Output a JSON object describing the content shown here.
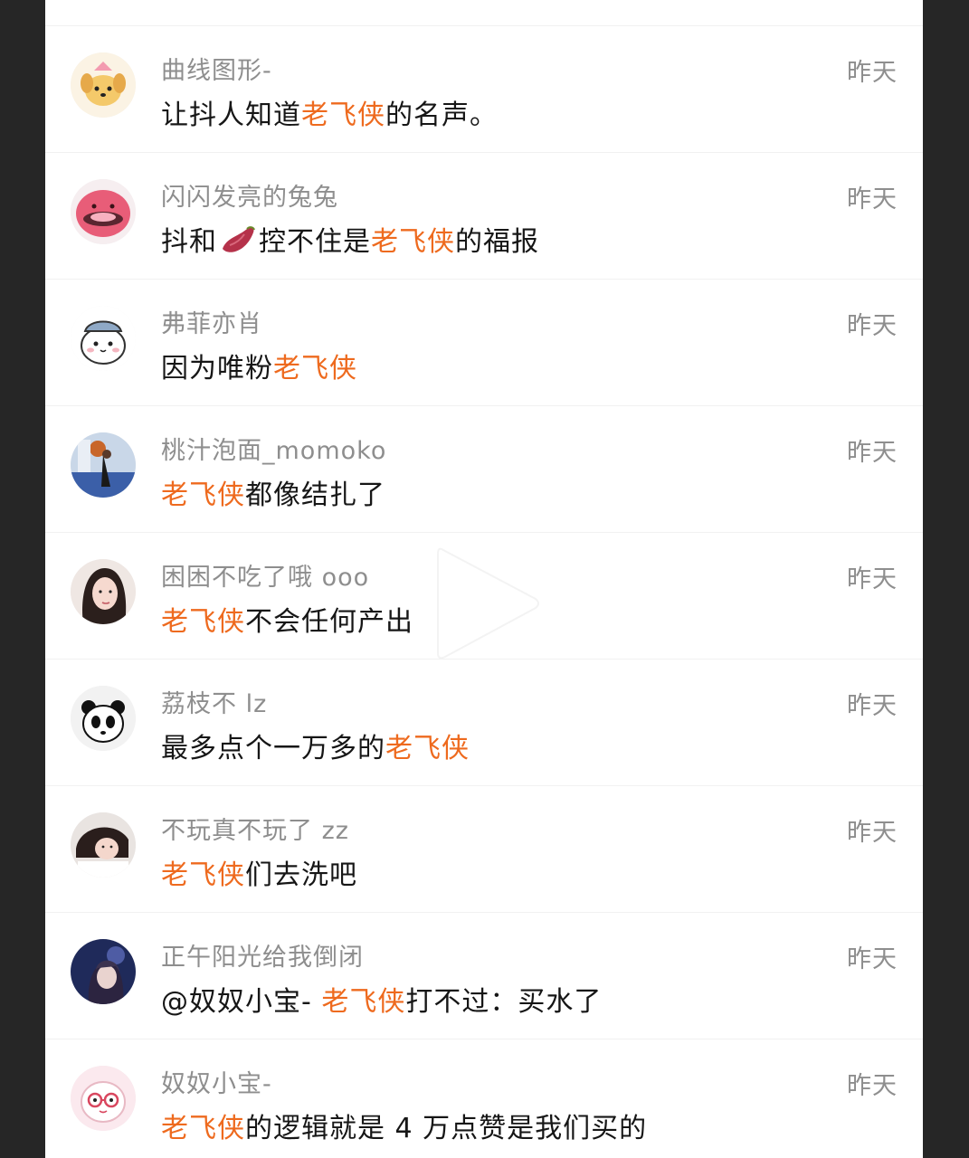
{
  "colors": {
    "highlight": "#ee6a1e",
    "username": "#8e8e8e",
    "text": "#161616",
    "frame": "#262626"
  },
  "comments": [
    {
      "username": "曲线图形-",
      "time": "昨天",
      "parts": [
        {
          "t": "让抖人知道",
          "hl": false
        },
        {
          "t": "老飞侠",
          "hl": true
        },
        {
          "t": "的名声。",
          "hl": false
        }
      ]
    },
    {
      "username": "闪闪发亮的兔兔",
      "time": "昨天",
      "parts": [
        {
          "t": "抖和",
          "hl": false
        },
        {
          "emoji": "sweet-potato-icon"
        },
        {
          "t": "控不住是",
          "hl": false
        },
        {
          "t": "老飞侠",
          "hl": true
        },
        {
          "t": "的福报",
          "hl": false
        }
      ]
    },
    {
      "username": "弗菲亦肖",
      "time": "昨天",
      "parts": [
        {
          "t": "因为唯粉",
          "hl": false
        },
        {
          "t": "老飞侠",
          "hl": true
        }
      ]
    },
    {
      "username": "桃汁泡面_momoko",
      "time": "昨天",
      "parts": [
        {
          "t": "老飞侠",
          "hl": true
        },
        {
          "t": "都像结扎了",
          "hl": false
        }
      ]
    },
    {
      "username": "困困不吃了哦 ooo",
      "time": "昨天",
      "parts": [
        {
          "t": "老飞侠",
          "hl": true
        },
        {
          "t": "不会任何产出",
          "hl": false
        }
      ]
    },
    {
      "username": "荔枝不 lz",
      "time": "昨天",
      "parts": [
        {
          "t": "最多点个一万多的",
          "hl": false
        },
        {
          "t": "老飞侠",
          "hl": true
        }
      ]
    },
    {
      "username": "不玩真不玩了 zz",
      "time": "昨天",
      "parts": [
        {
          "t": "老飞侠",
          "hl": true
        },
        {
          "t": "们去洗吧",
          "hl": false
        }
      ]
    },
    {
      "username": "正午阳光给我倒闭",
      "time": "昨天",
      "parts": [
        {
          "t": "@奴奴小宝- ",
          "hl": false
        },
        {
          "t": "老飞侠",
          "hl": true
        },
        {
          "t": "打不过：买水了",
          "hl": false
        }
      ]
    },
    {
      "username": "奴奴小宝-",
      "time": "昨天",
      "parts": [
        {
          "t": "老飞侠",
          "hl": true
        },
        {
          "t": "的逻辑就是 4 万点赞是我们买的",
          "hl": false
        }
      ]
    }
  ]
}
